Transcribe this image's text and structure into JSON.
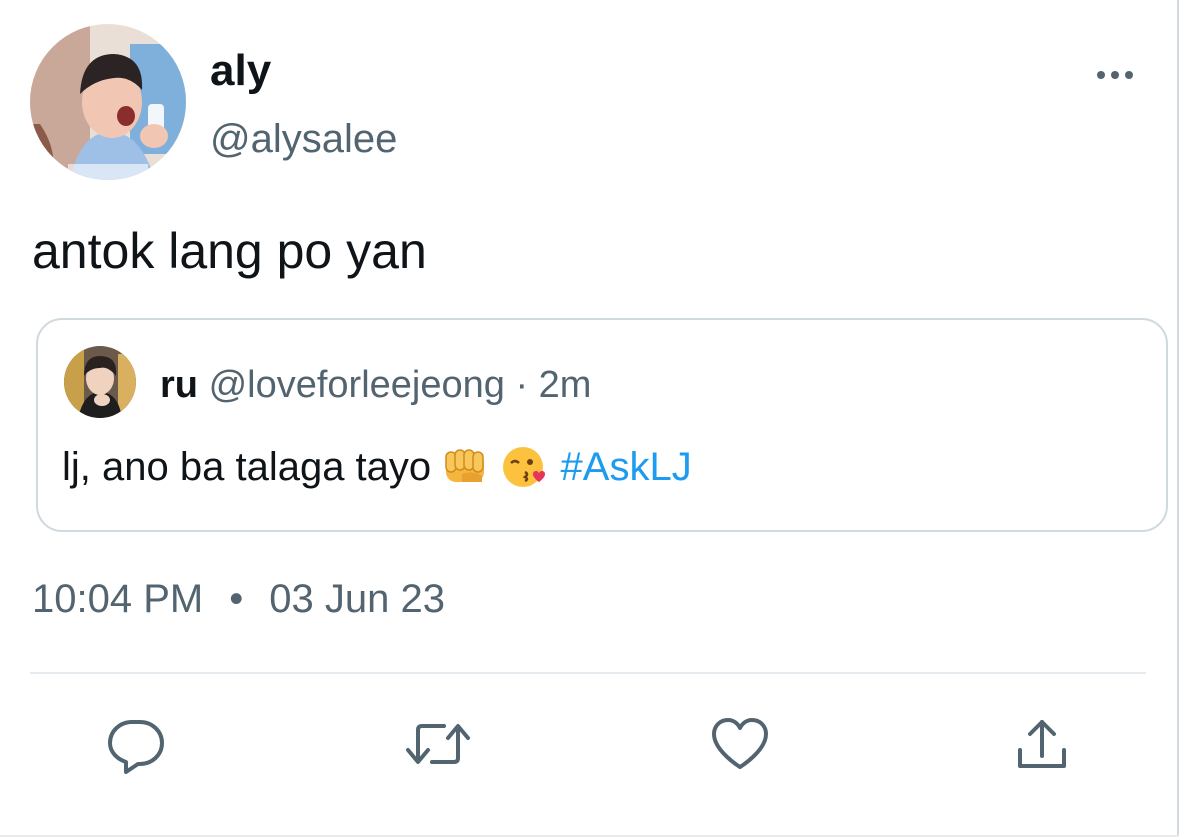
{
  "tweet": {
    "author": {
      "display_name": "aly",
      "handle": "@alysalee"
    },
    "text": "antok lang po yan",
    "quoted": {
      "display_name": "ru",
      "handle": "@loveforleejeong",
      "separator": "·",
      "time_ago": "2m",
      "text": "lj, ano ba talaga tayo",
      "emojis": [
        "fist-emoji",
        "kissing-face-heart-emoji"
      ],
      "hashtag": "#AskLJ"
    },
    "timestamp": {
      "time": "10:04 PM",
      "separator": "•",
      "date": "03 Jun 23"
    }
  },
  "actions": {
    "icons": [
      "reply-icon",
      "retweet-icon",
      "like-icon",
      "share-icon"
    ]
  },
  "colors": {
    "text_primary": "#0f1419",
    "text_secondary": "#536471",
    "link": "#1d9bf0",
    "border": "#cfd9de"
  }
}
